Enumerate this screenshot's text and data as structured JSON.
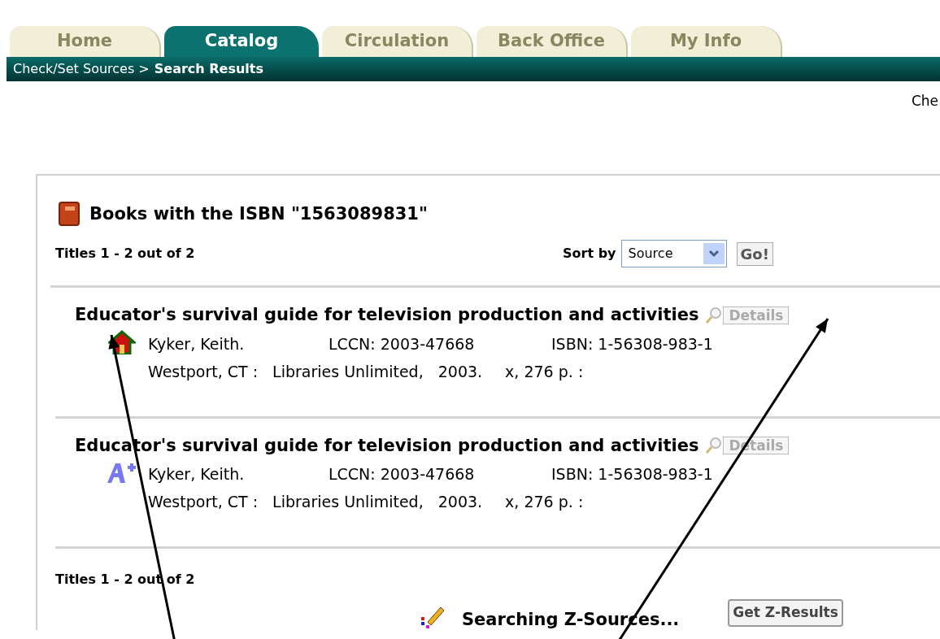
{
  "tabs": [
    {
      "label": "Home",
      "selected": false
    },
    {
      "label": "Catalog",
      "selected": true
    },
    {
      "label": "Circulation",
      "selected": false
    },
    {
      "label": "Back Office",
      "selected": false
    },
    {
      "label": "My Info",
      "selected": false
    }
  ],
  "breadcrumb": {
    "path": "Check/Set Sources >",
    "current": "Search Results"
  },
  "top_right_text": "Che",
  "results_header": {
    "title": "Books with the ISBN \"1563089831\"",
    "count": "Titles 1 - 2 out of 2",
    "sort_label": "Sort by",
    "sort_value": "Source",
    "go_button": "Go!"
  },
  "results": [
    {
      "kind": "local",
      "title": "Educator's survival guide for television production and activities",
      "details_button": "Details",
      "author": "Kyker, Keith.",
      "lccn": "LCCN: 2003-47668",
      "isbn": "ISBN: 1-56308-983-1",
      "place": "Westport, CT :",
      "publisher": "Libraries Unlimited,",
      "year": "2003.",
      "pages": "x, 276 p. :"
    },
    {
      "kind": "z-source",
      "title": "Educator's survival guide for television production and activities",
      "details_button": "Details",
      "author": "Kyker, Keith.",
      "lccn": "LCCN: 2003-47668",
      "isbn": "ISBN: 1-56308-983-1",
      "place": "Westport, CT :",
      "publisher": "Libraries Unlimited,",
      "year": "2003.",
      "pages": "x, 276 p. :"
    }
  ],
  "footer_count": "Titles 1 - 2 out of 2",
  "z_search": {
    "status": "Searching Z-Sources...",
    "get_button": "Get Z-Results"
  }
}
